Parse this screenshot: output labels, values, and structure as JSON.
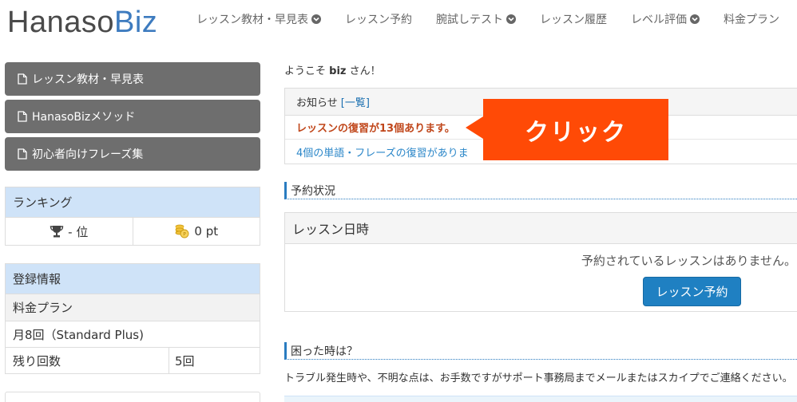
{
  "header": {
    "logo_part1": "Hanaso",
    "logo_part2": "Biz",
    "nav": [
      {
        "label": "レッスン教材・早見表",
        "dropdown": true
      },
      {
        "label": "レッスン予約",
        "dropdown": false
      },
      {
        "label": "腕試しテスト",
        "dropdown": true
      },
      {
        "label": "レッスン履歴",
        "dropdown": false
      },
      {
        "label": "レベル評価",
        "dropdown": true
      },
      {
        "label": "料金プラン",
        "dropdown": false
      }
    ]
  },
  "sidebar": {
    "buttons": [
      {
        "label": "レッスン教材・早見表",
        "icon": "document-icon"
      },
      {
        "label": "HanasoBizメソッド",
        "icon": "document-icon"
      },
      {
        "label": "初心者向けフレーズ集",
        "icon": "document-icon"
      }
    ],
    "ranking": {
      "title": "ランキング",
      "rank_value": "- 位",
      "points_value": "0 pt"
    },
    "registration": {
      "title": "登録情報",
      "plan_label": "料金プラン",
      "plan_value": "月8回（Standard Plus)",
      "remaining_label": "残り回数",
      "remaining_value": "5回"
    }
  },
  "main": {
    "welcome_prefix": "ようこそ",
    "username": "biz",
    "welcome_suffix": "さん！",
    "notice": {
      "title": "お知らせ",
      "list_link": "[一覧]",
      "alert": "レッスンの復習が13個あります。",
      "info": "4個の単語・フレーズの復習がありま"
    },
    "callout": "クリック",
    "reservation": {
      "section_title": "予約状況",
      "head": "レッスン日時",
      "empty_message": "予約されているレッスンはありません。",
      "button": "レッスン予約"
    },
    "help": {
      "section_title": "困った時は？",
      "text": "トラブル発生時や、不明な点は、お手数ですがサポート事務局までメールまたはスカイプでご連絡ください。"
    }
  },
  "colors": {
    "brand_blue": "#3d7bbf",
    "callout_orange": "#ff4a06",
    "alert_text": "#c0461a",
    "link_blue": "#2a86c8",
    "panel_head": "#cfe3f8",
    "sidebar_button": "#6e6e6e"
  }
}
